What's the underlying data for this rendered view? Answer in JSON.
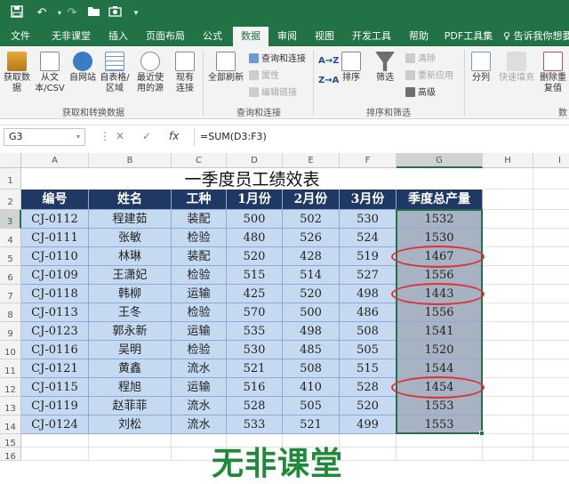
{
  "titlebar": {
    "icons": [
      "save-icon",
      "undo-icon",
      "redo-icon",
      "folder-open-icon",
      "camera-icon",
      "customize-icon"
    ]
  },
  "menu": {
    "tabs": [
      "文件",
      "无非课堂",
      "插入",
      "页面布局",
      "公式",
      "数据",
      "审阅",
      "视图",
      "开发工具",
      "帮助",
      "PDF工具集"
    ],
    "active": "数据",
    "tell_me": "告诉我你想要"
  },
  "ribbon": {
    "get_data": "获取数据",
    "from_text": "从文本/CSV",
    "from_web": "自网站",
    "from_table": "自表格/区域",
    "recent_sources": "最近使用的源",
    "existing_conn": "现有连接",
    "refresh_all": "全部刷新",
    "queries_conn": "查询和连接",
    "properties": "属性",
    "edit_links": "编辑链接",
    "sort_az": "A→Z",
    "sort_za": "Z→A",
    "sort": "排序",
    "filter": "筛选",
    "clear": "清除",
    "reapply": "重新应用",
    "advanced": "高级",
    "text_to_columns": "分列",
    "flash_fill": "快速填充",
    "remove_dup": "删除重复值",
    "group1": "获取和转换数据",
    "group2": "查询和连接",
    "group3": "排序和筛选",
    "group4": "数"
  },
  "formula_bar": {
    "name_box": "G3",
    "cancel": "✕",
    "enter": "✓",
    "fx": "fx",
    "formula": "=SUM(D3:F3)"
  },
  "sheet": {
    "columns": [
      "A",
      "B",
      "C",
      "D",
      "E",
      "F",
      "G",
      "H",
      "I"
    ],
    "rows": [
      "1",
      "2",
      "3",
      "4",
      "5",
      "6",
      "7",
      "8",
      "9",
      "10",
      "11",
      "12",
      "13",
      "14",
      "15",
      "16"
    ],
    "title": "一季度员工绩效表",
    "headers": [
      "编号",
      "姓名",
      "工种",
      "1月份",
      "2月份",
      "3月份",
      "季度总产量"
    ],
    "data": [
      [
        "CJ-0112",
        "程建茹",
        "装配",
        "500",
        "502",
        "530",
        "1532"
      ],
      [
        "CJ-0111",
        "张敏",
        "检验",
        "480",
        "526",
        "524",
        "1530"
      ],
      [
        "CJ-0110",
        "林琳",
        "装配",
        "520",
        "428",
        "519",
        "1467"
      ],
      [
        "CJ-0109",
        "王潇妃",
        "检验",
        "515",
        "514",
        "527",
        "1556"
      ],
      [
        "CJ-0118",
        "韩柳",
        "运输",
        "425",
        "520",
        "498",
        "1443"
      ],
      [
        "CJ-0113",
        "王冬",
        "检验",
        "570",
        "500",
        "486",
        "1556"
      ],
      [
        "CJ-0123",
        "郭永新",
        "运输",
        "535",
        "498",
        "508",
        "1541"
      ],
      [
        "CJ-0116",
        "吴明",
        "检验",
        "530",
        "485",
        "505",
        "1520"
      ],
      [
        "CJ-0121",
        "黄鑫",
        "流水",
        "521",
        "508",
        "515",
        "1544"
      ],
      [
        "CJ-0115",
        "程旭",
        "运输",
        "516",
        "410",
        "528",
        "1454"
      ],
      [
        "CJ-0119",
        "赵菲菲",
        "流水",
        "528",
        "505",
        "520",
        "1553"
      ],
      [
        "CJ-0124",
        "刘松",
        "流水",
        "533",
        "521",
        "499",
        "1553"
      ]
    ],
    "circled_rows": [
      2,
      4,
      9
    ],
    "selected_cell": "G3"
  },
  "watermark": "无非课堂",
  "colors": {
    "brand": "#217346",
    "header_fill": "#1f3864",
    "data_fill": "#c5d9f1",
    "circle": "#e03030"
  }
}
